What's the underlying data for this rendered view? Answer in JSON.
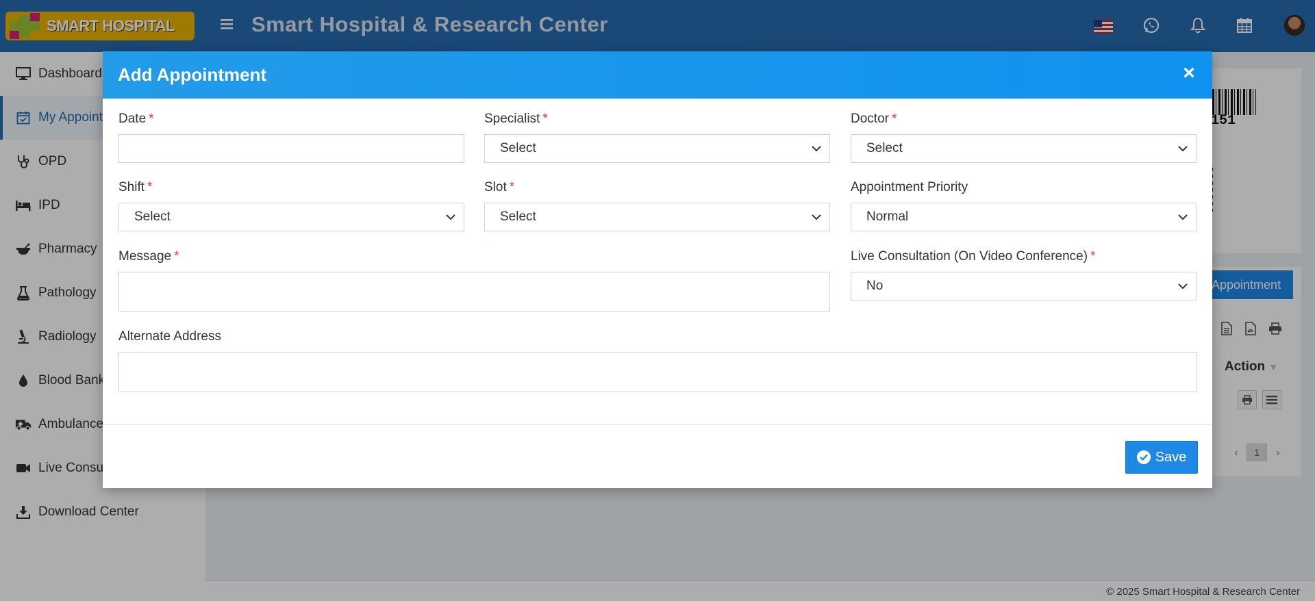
{
  "header": {
    "logo_text": "SMART HOSPITAL",
    "site_title": "Smart Hospital & Research Center",
    "menu_icon": "hamburger-icon",
    "icons": [
      "us-flag-icon",
      "whatsapp-icon",
      "bell-icon",
      "calendar-icon",
      "user-avatar"
    ]
  },
  "sidebar": {
    "items": [
      {
        "label": "Dashboard",
        "icon": "monitor-icon"
      },
      {
        "label": "My Appointments",
        "icon": "calendar-check-icon"
      },
      {
        "label": "OPD",
        "icon": "stethoscope-icon"
      },
      {
        "label": "IPD",
        "icon": "bed-icon"
      },
      {
        "label": "Pharmacy",
        "icon": "mortar-pestle-icon"
      },
      {
        "label": "Pathology",
        "icon": "flask-icon"
      },
      {
        "label": "Radiology",
        "icon": "microscope-icon"
      },
      {
        "label": "Blood Bank",
        "icon": "drop-icon"
      },
      {
        "label": "Ambulance",
        "icon": "ambulance-icon"
      },
      {
        "label": "Live Consultation",
        "icon": "video-icon"
      },
      {
        "label": "Download Center",
        "icon": "download-icon"
      }
    ]
  },
  "background": {
    "barcode_number": "151",
    "appointment_button": "Appointment",
    "table_action_header": "Action",
    "pager_prev": "‹",
    "pager_page": "1",
    "pager_next": "›"
  },
  "modal": {
    "title": "Add Appointment",
    "close": "×",
    "fields": {
      "date": {
        "label": "Date",
        "value": ""
      },
      "specialist": {
        "label": "Specialist",
        "value": "Select"
      },
      "doctor": {
        "label": "Doctor",
        "value": "Select"
      },
      "shift": {
        "label": "Shift",
        "value": "Select"
      },
      "slot": {
        "label": "Slot",
        "value": "Select"
      },
      "priority": {
        "label": "Appointment Priority",
        "value": "Normal"
      },
      "message": {
        "label": "Message",
        "value": ""
      },
      "live_consultation": {
        "label": "Live Consultation (On Video Conference)",
        "value": "No"
      },
      "alternate_address": {
        "label": "Alternate Address",
        "value": ""
      }
    },
    "required_mark": "*",
    "save_label": "Save"
  },
  "footer": {
    "copyright": "© 2025 Smart Hospital & Research Center"
  },
  "colors": {
    "header_bg": "#276bb0",
    "modal_header": "#1496ec",
    "primary_button": "#1e88e5",
    "required": "#e53935"
  }
}
